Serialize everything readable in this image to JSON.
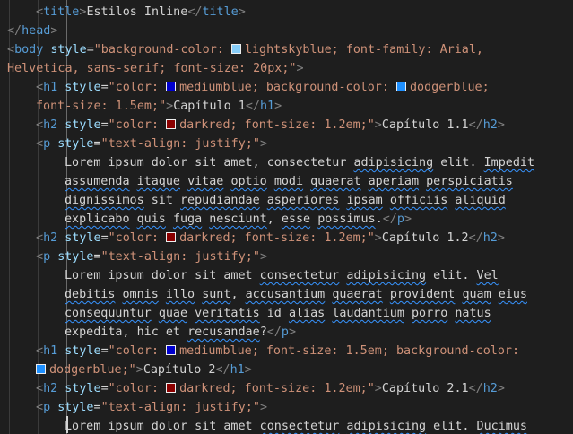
{
  "editor": {
    "colors": {
      "background": "#1e1e1e",
      "tag": "#569cd6",
      "punctuation": "#808080",
      "attribute": "#9cdcfe",
      "string": "#ce9178",
      "text": "#d4d4d4",
      "squiggle": "#3794ff"
    },
    "swatches": {
      "lightskyblue": "#87cefa",
      "mediumblue": "#0000cd",
      "dodgerblue": "#1e90ff",
      "darkred": "#8b0000"
    },
    "lines": [
      {
        "indent": 1,
        "guides": [
          0
        ],
        "tokens": [
          {
            "t": "pun",
            "v": "<"
          },
          {
            "t": "tag",
            "v": "title"
          },
          {
            "t": "pun",
            "v": ">"
          },
          {
            "t": "txt",
            "v": "Estilos Inline"
          },
          {
            "t": "pun",
            "v": "</"
          },
          {
            "t": "tag",
            "v": "title"
          },
          {
            "t": "pun",
            "v": ">"
          }
        ]
      },
      {
        "indent": 0,
        "guides": [],
        "tokens": [
          {
            "t": "pun",
            "v": "</"
          },
          {
            "t": "tag",
            "v": "head"
          },
          {
            "t": "pun",
            "v": ">"
          }
        ]
      },
      {
        "indent": 0,
        "guides": [],
        "tokens": [
          {
            "t": "pun",
            "v": "<"
          },
          {
            "t": "tag",
            "v": "body"
          },
          {
            "t": "txt",
            "v": " "
          },
          {
            "t": "attr",
            "v": "style"
          },
          {
            "t": "txt",
            "v": "="
          },
          {
            "t": "val",
            "v": "\"background-color: "
          },
          {
            "t": "sw",
            "c": "#87cefa"
          },
          {
            "t": "val",
            "v": "lightskyblue; font-family: Arial,"
          }
        ]
      },
      {
        "indent": 0,
        "guides": [],
        "tokens": [
          {
            "t": "val",
            "v": "Helvetica, sans-serif; font-size: 20px;\""
          },
          {
            "t": "pun",
            "v": ">"
          }
        ]
      },
      {
        "indent": 1,
        "guides": [
          0
        ],
        "tokens": [
          {
            "t": "pun",
            "v": "<"
          },
          {
            "t": "tag",
            "v": "h1"
          },
          {
            "t": "txt",
            "v": " "
          },
          {
            "t": "attr",
            "v": "style"
          },
          {
            "t": "txt",
            "v": "="
          },
          {
            "t": "val",
            "v": "\"color: "
          },
          {
            "t": "sw",
            "c": "#0000cd"
          },
          {
            "t": "val",
            "v": "mediumblue; background-color: "
          },
          {
            "t": "sw",
            "c": "#1e90ff"
          },
          {
            "t": "val",
            "v": "dodgerblue;"
          }
        ]
      },
      {
        "indent": 1,
        "guides": [
          0
        ],
        "tokens": [
          {
            "t": "val",
            "v": "font-size: 1.5em;\""
          },
          {
            "t": "pun",
            "v": ">"
          },
          {
            "t": "txt",
            "v": "Capítulo 1"
          },
          {
            "t": "pun",
            "v": "</"
          },
          {
            "t": "tag",
            "v": "h1"
          },
          {
            "t": "pun",
            "v": ">"
          }
        ]
      },
      {
        "indent": 1,
        "guides": [
          0
        ],
        "tokens": [
          {
            "t": "pun",
            "v": "<"
          },
          {
            "t": "tag",
            "v": "h2"
          },
          {
            "t": "txt",
            "v": " "
          },
          {
            "t": "attr",
            "v": "style"
          },
          {
            "t": "txt",
            "v": "="
          },
          {
            "t": "val",
            "v": "\"color: "
          },
          {
            "t": "sw",
            "c": "#8b0000"
          },
          {
            "t": "val",
            "v": "darkred; font-size: 1.2em;\""
          },
          {
            "t": "pun",
            "v": ">"
          },
          {
            "t": "txt",
            "v": "Capítulo 1.1"
          },
          {
            "t": "pun",
            "v": "</"
          },
          {
            "t": "tag",
            "v": "h2"
          },
          {
            "t": "pun",
            "v": ">"
          }
        ]
      },
      {
        "indent": 1,
        "guides": [
          0
        ],
        "tokens": [
          {
            "t": "pun",
            "v": "<"
          },
          {
            "t": "tag",
            "v": "p"
          },
          {
            "t": "txt",
            "v": " "
          },
          {
            "t": "attr",
            "v": "style"
          },
          {
            "t": "txt",
            "v": "="
          },
          {
            "t": "val",
            "v": "\"text-align: justify;\""
          },
          {
            "t": "pun",
            "v": ">"
          }
        ]
      },
      {
        "indent": 2,
        "guides": [
          0,
          1
        ],
        "tokens": [
          {
            "t": "txt",
            "v": "Lorem ipsum dolor sit amet, consectetur "
          },
          {
            "t": "sq",
            "v": "adipisicing"
          },
          {
            "t": "txt",
            "v": " elit. "
          },
          {
            "t": "sq",
            "v": "Impedit"
          }
        ]
      },
      {
        "indent": 2,
        "guides": [
          0,
          1
        ],
        "tokens": [
          {
            "t": "sq",
            "v": "assumenda"
          },
          {
            "t": "txt",
            "v": " "
          },
          {
            "t": "sq",
            "v": "itaque"
          },
          {
            "t": "txt",
            "v": " "
          },
          {
            "t": "sq",
            "v": "vitae"
          },
          {
            "t": "txt",
            "v": " "
          },
          {
            "t": "sq",
            "v": "optio"
          },
          {
            "t": "txt",
            "v": " "
          },
          {
            "t": "sq",
            "v": "modi"
          },
          {
            "t": "txt",
            "v": " "
          },
          {
            "t": "sq",
            "v": "quaerat"
          },
          {
            "t": "txt",
            "v": " "
          },
          {
            "t": "sq",
            "v": "aperiam"
          },
          {
            "t": "txt",
            "v": " "
          },
          {
            "t": "sq",
            "v": "perspiciatis"
          }
        ]
      },
      {
        "indent": 2,
        "guides": [
          0,
          1
        ],
        "tokens": [
          {
            "t": "sq",
            "v": "dignissimos"
          },
          {
            "t": "txt",
            "v": " sit "
          },
          {
            "t": "sq",
            "v": "repudiandae"
          },
          {
            "t": "txt",
            "v": " "
          },
          {
            "t": "sq",
            "v": "asperiores"
          },
          {
            "t": "txt",
            "v": " "
          },
          {
            "t": "sq",
            "v": "ipsam"
          },
          {
            "t": "txt",
            "v": " "
          },
          {
            "t": "sq",
            "v": "officiis"
          },
          {
            "t": "txt",
            "v": " "
          },
          {
            "t": "sq",
            "v": "aliquid"
          }
        ]
      },
      {
        "indent": 2,
        "guides": [
          0,
          1
        ],
        "tokens": [
          {
            "t": "sq",
            "v": "explicabo"
          },
          {
            "t": "txt",
            "v": " "
          },
          {
            "t": "sq",
            "v": "quis"
          },
          {
            "t": "txt",
            "v": " "
          },
          {
            "t": "sq",
            "v": "fuga"
          },
          {
            "t": "txt",
            "v": " "
          },
          {
            "t": "sq",
            "v": "nesciunt"
          },
          {
            "t": "txt",
            "v": ", "
          },
          {
            "t": "sq",
            "v": "esse"
          },
          {
            "t": "txt",
            "v": " "
          },
          {
            "t": "sq",
            "v": "possimus"
          },
          {
            "t": "txt",
            "v": "."
          },
          {
            "t": "pun",
            "v": "</"
          },
          {
            "t": "tag",
            "v": "p"
          },
          {
            "t": "pun",
            "v": ">"
          }
        ]
      },
      {
        "indent": 1,
        "guides": [
          0
        ],
        "tokens": [
          {
            "t": "pun",
            "v": "<"
          },
          {
            "t": "tag",
            "v": "h2"
          },
          {
            "t": "txt",
            "v": " "
          },
          {
            "t": "attr",
            "v": "style"
          },
          {
            "t": "txt",
            "v": "="
          },
          {
            "t": "val",
            "v": "\"color: "
          },
          {
            "t": "sw",
            "c": "#8b0000"
          },
          {
            "t": "val",
            "v": "darkred; font-size: 1.2em;\""
          },
          {
            "t": "pun",
            "v": ">"
          },
          {
            "t": "txt",
            "v": "Capítulo 1.2"
          },
          {
            "t": "pun",
            "v": "</"
          },
          {
            "t": "tag",
            "v": "h2"
          },
          {
            "t": "pun",
            "v": ">"
          }
        ]
      },
      {
        "indent": 1,
        "guides": [
          0
        ],
        "tokens": [
          {
            "t": "pun",
            "v": "<"
          },
          {
            "t": "tag",
            "v": "p"
          },
          {
            "t": "txt",
            "v": " "
          },
          {
            "t": "attr",
            "v": "style"
          },
          {
            "t": "txt",
            "v": "="
          },
          {
            "t": "val",
            "v": "\"text-align: justify;\""
          },
          {
            "t": "pun",
            "v": ">"
          }
        ]
      },
      {
        "indent": 2,
        "guides": [
          0,
          1
        ],
        "tokens": [
          {
            "t": "txt",
            "v": "Lorem ipsum dolor sit amet "
          },
          {
            "t": "sq",
            "v": "consectetur"
          },
          {
            "t": "txt",
            "v": " "
          },
          {
            "t": "sq",
            "v": "adipisicing"
          },
          {
            "t": "txt",
            "v": " elit. "
          },
          {
            "t": "sq",
            "v": "Vel"
          }
        ]
      },
      {
        "indent": 2,
        "guides": [
          0,
          1
        ],
        "tokens": [
          {
            "t": "sq",
            "v": "debitis"
          },
          {
            "t": "txt",
            "v": " "
          },
          {
            "t": "sq",
            "v": "omnis"
          },
          {
            "t": "txt",
            "v": " "
          },
          {
            "t": "sq",
            "v": "illo"
          },
          {
            "t": "txt",
            "v": " "
          },
          {
            "t": "sq",
            "v": "sunt"
          },
          {
            "t": "txt",
            "v": ", "
          },
          {
            "t": "sq",
            "v": "accusantium"
          },
          {
            "t": "txt",
            "v": " "
          },
          {
            "t": "sq",
            "v": "quaerat"
          },
          {
            "t": "txt",
            "v": " "
          },
          {
            "t": "sq",
            "v": "provident"
          },
          {
            "t": "txt",
            "v": " "
          },
          {
            "t": "sq",
            "v": "quam"
          },
          {
            "t": "txt",
            "v": " "
          },
          {
            "t": "sq",
            "v": "eius"
          }
        ]
      },
      {
        "indent": 2,
        "guides": [
          0,
          1
        ],
        "tokens": [
          {
            "t": "sq",
            "v": "consequuntur"
          },
          {
            "t": "txt",
            "v": " "
          },
          {
            "t": "sq",
            "v": "quae"
          },
          {
            "t": "txt",
            "v": " "
          },
          {
            "t": "sq",
            "v": "veritatis"
          },
          {
            "t": "txt",
            "v": " id "
          },
          {
            "t": "sq",
            "v": "alias"
          },
          {
            "t": "txt",
            "v": " "
          },
          {
            "t": "sq",
            "v": "laudantium"
          },
          {
            "t": "txt",
            "v": " "
          },
          {
            "t": "sq",
            "v": "porro"
          },
          {
            "t": "txt",
            "v": " "
          },
          {
            "t": "sq",
            "v": "natus"
          }
        ]
      },
      {
        "indent": 2,
        "guides": [
          0,
          1
        ],
        "tokens": [
          {
            "t": "txt",
            "v": "expedita, hic et "
          },
          {
            "t": "sq",
            "v": "recusandae"
          },
          {
            "t": "txt",
            "v": "?"
          },
          {
            "t": "pun",
            "v": "</"
          },
          {
            "t": "tag",
            "v": "p"
          },
          {
            "t": "pun",
            "v": ">"
          }
        ]
      },
      {
        "indent": 1,
        "guides": [
          0
        ],
        "tokens": [
          {
            "t": "pun",
            "v": "<"
          },
          {
            "t": "tag",
            "v": "h1"
          },
          {
            "t": "txt",
            "v": " "
          },
          {
            "t": "attr",
            "v": "style"
          },
          {
            "t": "txt",
            "v": "="
          },
          {
            "t": "val",
            "v": "\"color: "
          },
          {
            "t": "sw",
            "c": "#0000cd"
          },
          {
            "t": "val",
            "v": "mediumblue; font-size: 1.5em; background-color:"
          }
        ]
      },
      {
        "indent": 1,
        "guides": [
          0
        ],
        "tokens": [
          {
            "t": "sw",
            "c": "#1e90ff"
          },
          {
            "t": "val",
            "v": "dodgerblue;\""
          },
          {
            "t": "pun",
            "v": ">"
          },
          {
            "t": "txt",
            "v": "Capítulo 2"
          },
          {
            "t": "pun",
            "v": "</"
          },
          {
            "t": "tag",
            "v": "h1"
          },
          {
            "t": "pun",
            "v": ">"
          }
        ]
      },
      {
        "indent": 1,
        "guides": [
          0
        ],
        "tokens": [
          {
            "t": "pun",
            "v": "<"
          },
          {
            "t": "tag",
            "v": "h2"
          },
          {
            "t": "txt",
            "v": " "
          },
          {
            "t": "attr",
            "v": "style"
          },
          {
            "t": "txt",
            "v": "="
          },
          {
            "t": "val",
            "v": "\"color: "
          },
          {
            "t": "sw",
            "c": "#8b0000"
          },
          {
            "t": "val",
            "v": "darkred; font-size: 1.2em;\""
          },
          {
            "t": "pun",
            "v": ">"
          },
          {
            "t": "txt",
            "v": "Capítulo 2.1"
          },
          {
            "t": "pun",
            "v": "</"
          },
          {
            "t": "tag",
            "v": "h2"
          },
          {
            "t": "pun",
            "v": ">"
          }
        ]
      },
      {
        "indent": 1,
        "guides": [
          0
        ],
        "tokens": [
          {
            "t": "pun",
            "v": "<"
          },
          {
            "t": "tag",
            "v": "p"
          },
          {
            "t": "txt",
            "v": " "
          },
          {
            "t": "attr",
            "v": "style"
          },
          {
            "t": "txt",
            "v": "="
          },
          {
            "t": "val",
            "v": "\"text-align: justify;\""
          },
          {
            "t": "pun",
            "v": ">"
          }
        ]
      },
      {
        "indent": 2,
        "guides": [
          0,
          1
        ],
        "tokens": [
          {
            "t": "txt",
            "v": "Lorem ipsum dolor sit amet "
          },
          {
            "t": "sq",
            "v": "consectetur"
          },
          {
            "t": "txt",
            "v": " "
          },
          {
            "t": "sq",
            "v": "adipisicing"
          },
          {
            "t": "txt",
            "v": " elit. "
          },
          {
            "t": "sq",
            "v": "Ducimus"
          }
        ]
      }
    ]
  }
}
